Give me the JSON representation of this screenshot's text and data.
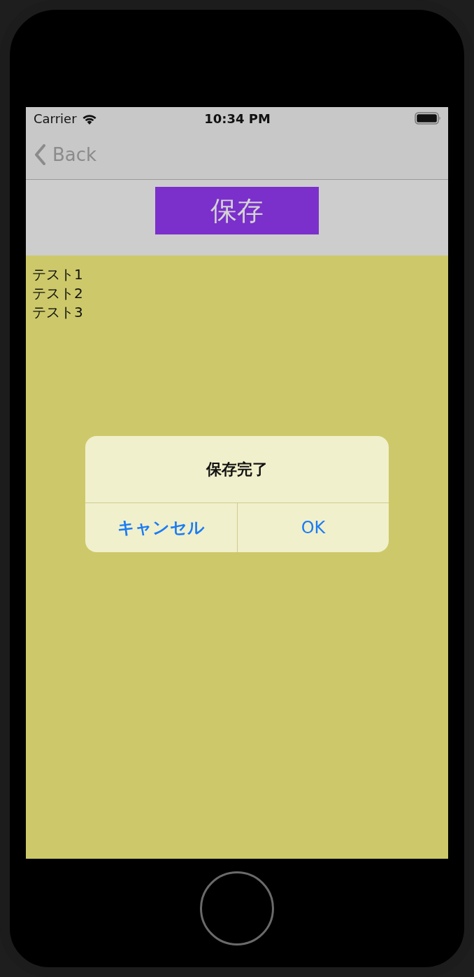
{
  "status_bar": {
    "carrier": "Carrier",
    "time": "10:34 PM"
  },
  "navigation_bar": {
    "back_label": "Back"
  },
  "toolbar": {
    "save_button": "保存"
  },
  "content": {
    "lines": [
      "テスト1",
      "テスト2",
      "テスト3"
    ]
  },
  "alert": {
    "title": "保存完了",
    "actions": [
      {
        "label": "キャンセル",
        "kind": "cancel"
      },
      {
        "label": "OK",
        "kind": "default"
      }
    ]
  }
}
